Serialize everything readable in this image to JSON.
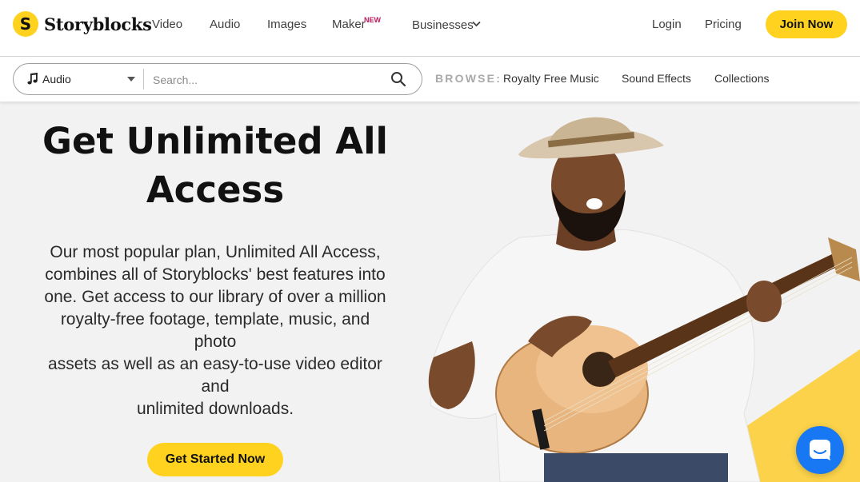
{
  "brand": {
    "name": "Storyblocks",
    "mark": "S"
  },
  "nav": {
    "video": "Video",
    "audio": "Audio",
    "images": "Images",
    "maker": "Maker",
    "maker_badge": "NEW",
    "businesses": "Businesses",
    "login": "Login",
    "pricing": "Pricing",
    "join": "Join Now"
  },
  "search": {
    "category": "Audio",
    "placeholder": "Search...",
    "browse_label": "BROWSE:",
    "browse_links": [
      "Royalty Free Music",
      "Sound Effects",
      "Collections"
    ]
  },
  "hero": {
    "title_line1": "Get Unlimited All",
    "title_line2": "Access",
    "body_lines": [
      "Our most popular plan, Unlimited All Access,",
      "combines all of Storyblocks' best features into",
      "one. Get access to our library of over a million",
      "royalty-free footage, template, music, and photo",
      "assets as well as an easy-to-use video editor and",
      "unlimited downloads."
    ],
    "cta": "Get Started Now"
  },
  "icons": {
    "logo": "storyblocks-logo-icon",
    "dropdown": "chevron-down-icon",
    "category": "music-note-icon",
    "search": "search-icon",
    "chat": "chat-icon"
  },
  "colors": {
    "accent": "#ffd21f",
    "background": "#f3f2f2",
    "chat": "#1877f2",
    "new_badge": "#c2185b"
  }
}
